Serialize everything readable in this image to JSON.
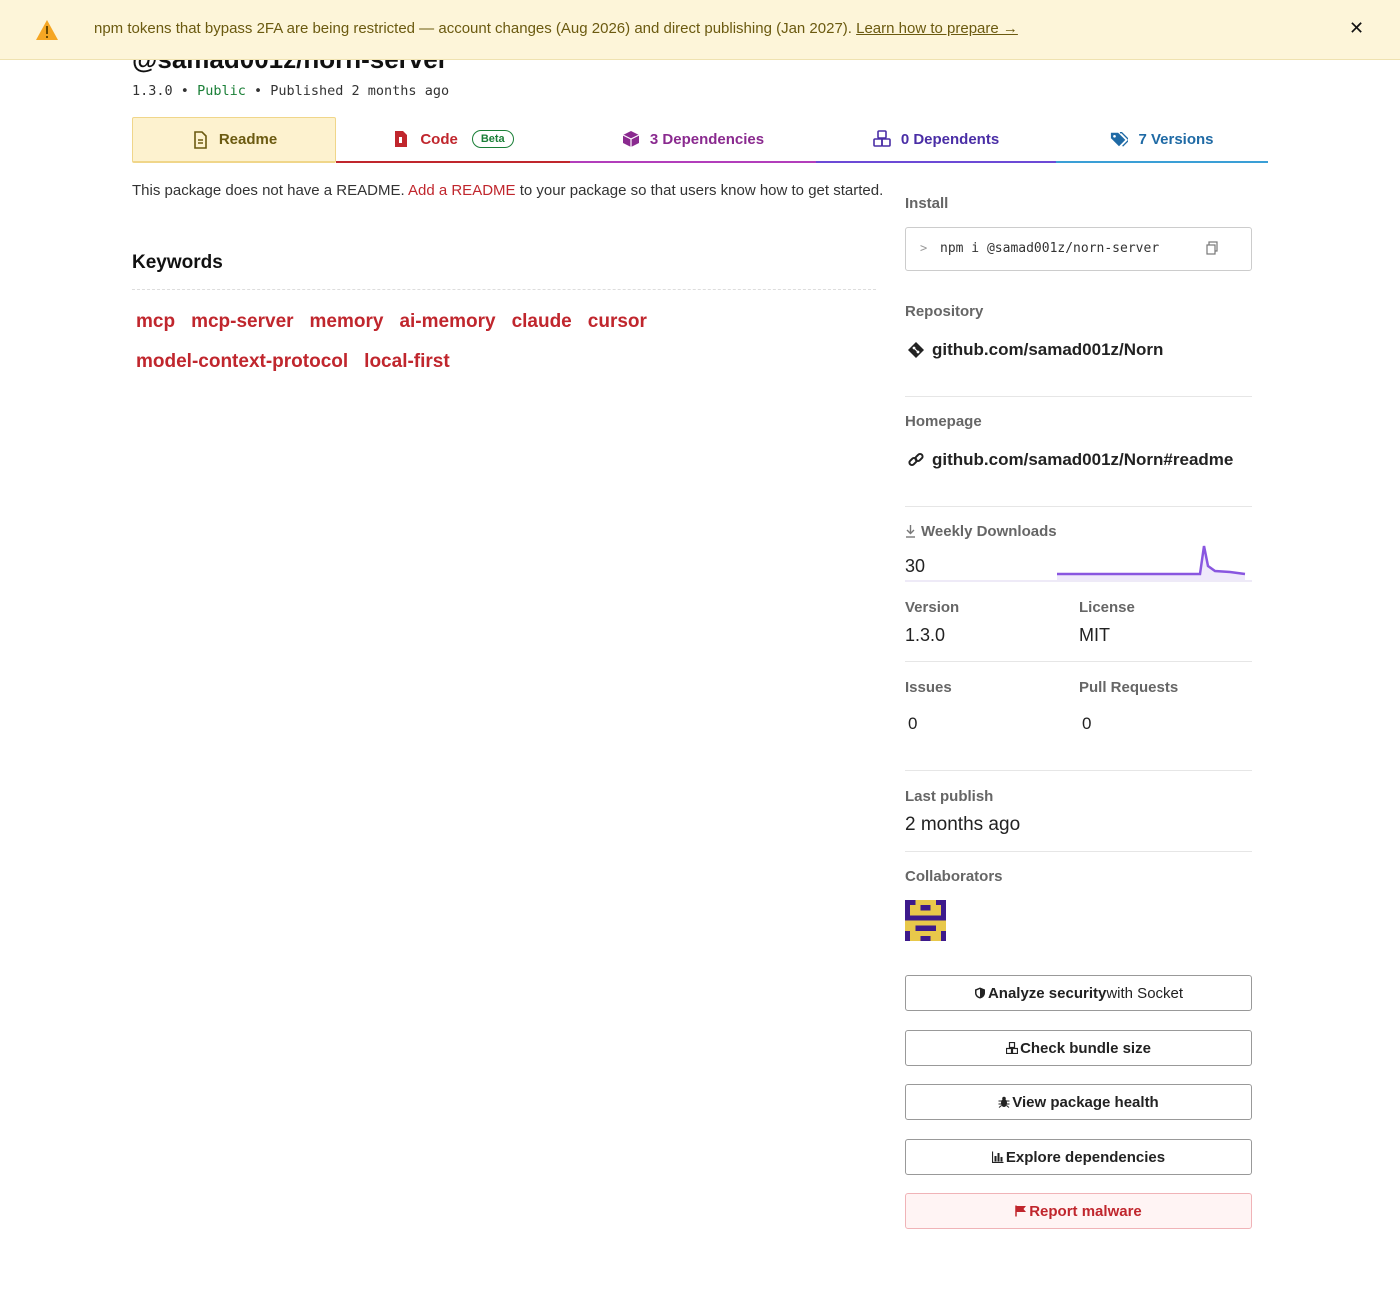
{
  "banner": {
    "message": "npm tokens that bypass 2FA are being restricted — account changes (Aug 2026) and direct publishing (Jan 2027). ",
    "link": "Learn how to prepare →",
    "close": "✕",
    "icon": "warning-icon"
  },
  "package": {
    "title": "@samad001z/norn-server",
    "version": "1.3.0",
    "sep1": "•",
    "visibility": "Public",
    "sep2": "•",
    "published": "Published 2 months ago"
  },
  "tabs": {
    "readme": "Readme",
    "code": "Code",
    "code_badge": "Beta",
    "dependencies": "3 Dependencies",
    "dependents": "0 Dependents",
    "versions": "7 Versions"
  },
  "readme": {
    "prefix": "This package does not have a README. ",
    "link": "Add a README",
    "suffix": " to your package so that users know how to get started."
  },
  "keywords": {
    "heading": "Keywords",
    "items": [
      "mcp",
      "mcp-server",
      "memory",
      "ai-memory",
      "claude",
      "cursor",
      "model-context-protocol",
      "local-first"
    ]
  },
  "sidebar": {
    "install_label": "Install",
    "install_prompt": ">",
    "install_cmd": "npm i @samad001z/norn-server",
    "repository_label": "Repository",
    "repository": "github.com/samad001z/Norn",
    "homepage_label": "Homepage",
    "homepage": "github.com/samad001z/Norn#readme",
    "downloads_label": "Weekly Downloads",
    "downloads": "30",
    "version_label": "Version",
    "version": "1.3.0",
    "license_label": "License",
    "license": "MIT",
    "issues_label": "Issues",
    "issues": "0",
    "prs_label": "Pull Requests",
    "prs": "0",
    "last_publish_label": "Last publish",
    "last_publish": "2 months ago",
    "collaborators_label": "Collaborators"
  },
  "buttons": {
    "socket_bold": "Analyze security",
    "socket_rest": " with Socket",
    "bundle": "Check bundle size",
    "health": "View package health",
    "explore": "Explore dependencies",
    "report": "Report malware"
  },
  "colors": {
    "banner_bg": "#fdf5d9",
    "link_red": "#c0262d",
    "sparkline": "#8956e0",
    "public_green": "#1a7f37"
  }
}
